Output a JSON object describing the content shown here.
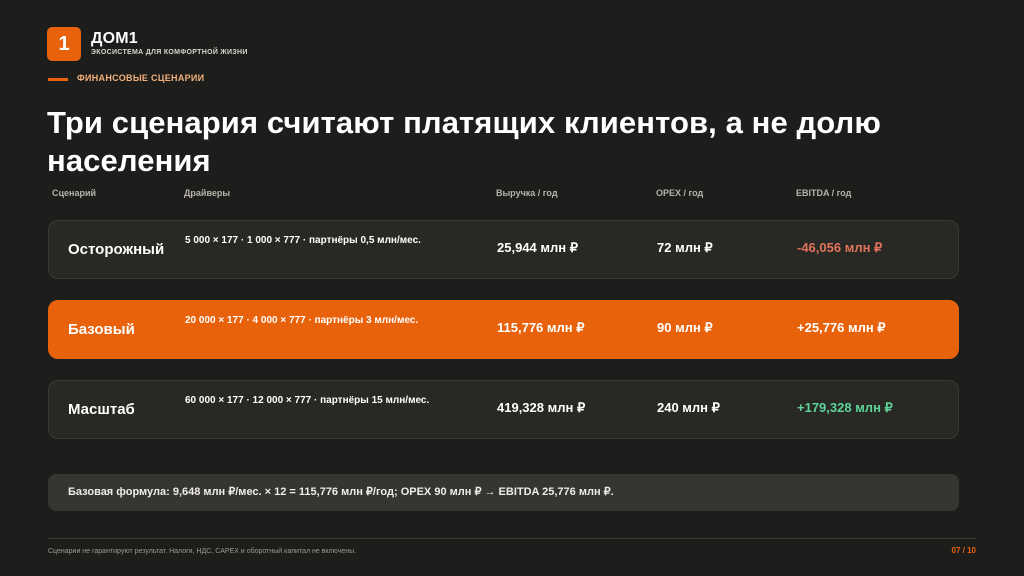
{
  "brand": {
    "logo_text": "1",
    "name": "ДОМ1",
    "tagline": "ЭКОСИСТЕМА ДЛЯ КОМФОРТНОЙ ЖИЗНИ"
  },
  "section_label": "ФИНАНСОВЫЕ СЦЕНАРИИ",
  "title": "Три сценария считают платящих клиентов, а не долю населения",
  "table": {
    "headers": {
      "scenario": "Сценарий",
      "drivers": "Драйверы",
      "revenue": "Выручка / год",
      "opex": "OPEX / год",
      "ebitda": "EBITDA / год"
    },
    "rows": [
      {
        "name": "Осторожный",
        "drivers": "5 000 × 177 · 1 000 × 777 · партнёры 0,5 млн/мес.",
        "revenue": "25,944 млн ₽",
        "opex": "72 млн ₽",
        "ebitda": "-46,056 млн ₽"
      },
      {
        "name": "Базовый",
        "drivers": "20 000 × 177 · 4 000 × 777 · партнёры 3 млн/мес.",
        "revenue": "115,776 млн ₽",
        "opex": "90 млн ₽",
        "ebitda": "+25,776 млн ₽"
      },
      {
        "name": "Масштаб",
        "drivers": "60 000 × 177 · 12 000 × 777 · партнёры 15 млн/мес.",
        "revenue": "419,328 млн ₽",
        "opex": "240 млн ₽",
        "ebitda": "+179,328 млн ₽"
      }
    ]
  },
  "formula": "Базовая формула: 9,648 млн ₽/мес. × 12 = 115,776 млн ₽/год; OPEX 90 млн ₽ → EBITDA 25,776 млн ₽.",
  "footer": {
    "note": "Сценарии не гарантируют результат. Налоги, НДС, CAPEX и оборотный капитал не включены.",
    "page": "07 / 10"
  },
  "colors": {
    "accent": "#e8620c",
    "negative": "#e0735a",
    "positive": "#5fd49a",
    "background": "#1d1d1b"
  }
}
